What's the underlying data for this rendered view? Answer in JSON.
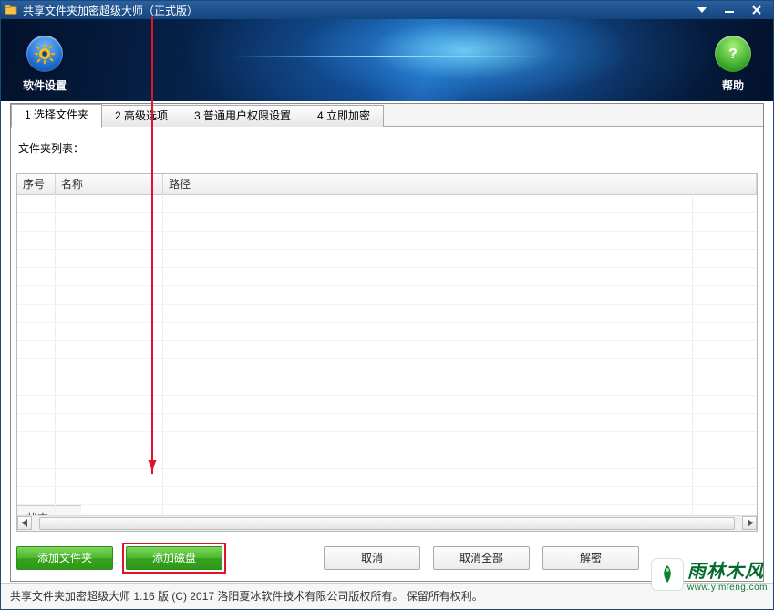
{
  "window": {
    "title": "共享文件夹加密超级大师（正式版）"
  },
  "banner": {
    "settings_label": "软件设置",
    "help_label": "帮助"
  },
  "tabs": [
    {
      "label": "1 选择文件夹",
      "active": true
    },
    {
      "label": "2 高级选项"
    },
    {
      "label": "3 普通用户权限设置"
    },
    {
      "label": "4 立即加密"
    }
  ],
  "list_label": "文件夹列表：",
  "columns": {
    "seq": "序号",
    "name": "名称",
    "path": "路径",
    "status": "状态"
  },
  "rows": [],
  "buttons": {
    "add_folder": "添加文件夹",
    "add_disk": "添加磁盘",
    "cancel": "取消",
    "cancel_all": "取消全部",
    "decrypt": "解密"
  },
  "statusbar": "共享文件夹加密超级大师 1.16 版  (C)  2017 洛阳夏冰软件技术有限公司版权所有。 保留所有权利。",
  "watermark": {
    "cn": "雨林木风",
    "en": "www.ylmfeng.com"
  }
}
